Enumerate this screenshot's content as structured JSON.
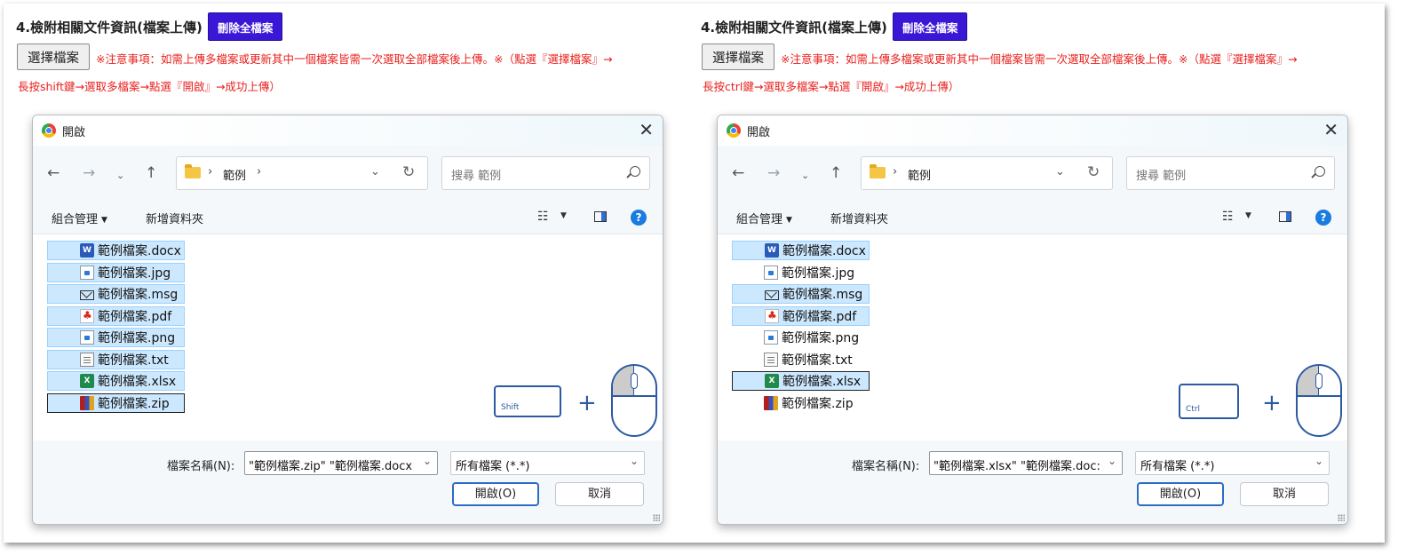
{
  "panels": [
    {
      "heading": "4.檢附相關文件資訊(檔案上傳)",
      "delete_all_label": "刪除全檔案",
      "choose_file_label": "選擇檔案",
      "notice_line1": "※注意事項：如需上傳多檔案或更新其中一個檔案皆需一次選取全部檔案後上傳。※（點選『選擇檔案』→",
      "notice_line2": "長按shift鍵→選取多檔案→點選『開啟』→成功上傳）",
      "dialog": {
        "title": "開啟",
        "breadcrumb": "範例",
        "search_placeholder": "搜尋 範例",
        "organize_label": "組合管理",
        "new_folder_label": "新增資料夾",
        "files": [
          {
            "name": "範例檔案.docx",
            "icon": "word-icon",
            "selected": true,
            "focused": false
          },
          {
            "name": "範例檔案.jpg",
            "icon": "image-icon",
            "selected": true,
            "focused": false
          },
          {
            "name": "範例檔案.msg",
            "icon": "mail-icon",
            "selected": true,
            "focused": false
          },
          {
            "name": "範例檔案.pdf",
            "icon": "pdf-icon",
            "selected": true,
            "focused": false
          },
          {
            "name": "範例檔案.png",
            "icon": "image-icon",
            "selected": true,
            "focused": false
          },
          {
            "name": "範例檔案.txt",
            "icon": "text-icon",
            "selected": true,
            "focused": false
          },
          {
            "name": "範例檔案.xlsx",
            "icon": "excel-icon",
            "selected": true,
            "focused": false
          },
          {
            "name": "範例檔案.zip",
            "icon": "zip-icon",
            "selected": true,
            "focused": true
          }
        ],
        "key_label": "Shift",
        "filename_label": "檔案名稱(N):",
        "filename_value": "\"範例檔案.zip\" \"範例檔案.docx",
        "filetype_value": "所有檔案 (*.*)",
        "open_label": "開啟(O)",
        "cancel_label": "取消"
      }
    },
    {
      "heading": "4.檢附相關文件資訊(檔案上傳)",
      "delete_all_label": "刪除全檔案",
      "choose_file_label": "選擇檔案",
      "notice_line1": "※注意事項：如需上傳多檔案或更新其中一個檔案皆需一次選取全部檔案後上傳。※（點選『選擇檔案』→",
      "notice_line2": "長按ctrl鍵→選取多檔案→點選『開啟』→成功上傳）",
      "dialog": {
        "title": "開啟",
        "breadcrumb": "範例",
        "search_placeholder": "搜尋 範例",
        "organize_label": "組合管理",
        "new_folder_label": "新增資料夾",
        "files": [
          {
            "name": "範例檔案.docx",
            "icon": "word-icon",
            "selected": true,
            "focused": false
          },
          {
            "name": "範例檔案.jpg",
            "icon": "image-icon",
            "selected": false,
            "focused": false
          },
          {
            "name": "範例檔案.msg",
            "icon": "mail-icon",
            "selected": true,
            "focused": false
          },
          {
            "name": "範例檔案.pdf",
            "icon": "pdf-icon",
            "selected": true,
            "focused": false
          },
          {
            "name": "範例檔案.png",
            "icon": "image-icon",
            "selected": false,
            "focused": false
          },
          {
            "name": "範例檔案.txt",
            "icon": "text-icon",
            "selected": false,
            "focused": false
          },
          {
            "name": "範例檔案.xlsx",
            "icon": "excel-icon",
            "selected": true,
            "focused": true
          },
          {
            "name": "範例檔案.zip",
            "icon": "zip-icon",
            "selected": false,
            "focused": false
          }
        ],
        "key_label": "Ctrl",
        "filename_value": "\"範例檔案.xlsx\" \"範例檔案.doc:",
        "filename_label": "檔案名稱(N):",
        "filetype_value": "所有檔案 (*.*)",
        "open_label": "開啟(O)",
        "cancel_label": "取消"
      }
    }
  ],
  "icon_glyphs": {
    "word-icon": "W",
    "excel-icon": "X"
  },
  "colors": {
    "accent": "#3a17d6",
    "notice": "#e8211e",
    "selection": "#cce8ff",
    "key_outline": "#2c5aa0"
  }
}
